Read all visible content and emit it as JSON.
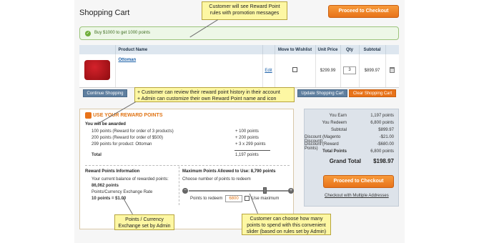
{
  "header": {
    "title": "Shopping Cart",
    "checkout_top": "Proceed to Checkout"
  },
  "promo": {
    "message": "Buy $1000 to get 1000 points"
  },
  "callouts": {
    "top": "Customer will see Reward Point rules with promotion messages",
    "middle_1": "+ Customer can review their reward point history in their account",
    "middle_2": "+ Admin can customize their own Reward Point name and icon",
    "bottom_left": "Points / Currency Exchange set by Admin",
    "bottom_right": "Customer can choose how many points to spend with this convenient slider (based on rules set by Admin)"
  },
  "cart": {
    "columns": [
      "Product Name",
      "Move to Wishlist",
      "Unit Price",
      "Qty",
      "Subtotal"
    ],
    "item": {
      "name": "Ottoman",
      "edit": "Edit",
      "price": "$299.99",
      "qty": "3",
      "subtotal": "$899.97"
    },
    "continue": "Continue Shopping",
    "update": "Update Shopping Cart",
    "clear": "Clear Shopping Cart"
  },
  "reward": {
    "title": "USE YOUR REWARD POINTS",
    "will_be": "You will be awarded",
    "lines": [
      {
        "label": "100 points (Reward for order of 3 products)",
        "value": "+ 100 points"
      },
      {
        "label": "200 points (Reward for order of $500)",
        "value": "+ 200 points"
      },
      {
        "label": "299 points for product: Ottoman",
        "value": "+ 3 x 299 points"
      }
    ],
    "total_label": "Total",
    "total_value": "1,197 points",
    "info_title": "Reward Points Information",
    "balance_label": "Your current balance of rewarded points:",
    "balance_value": "86,062 points",
    "rate_label": "Points/Currency Exchange Rate",
    "rate_value": "10 points = $1.00",
    "max_title": "Maximum Points Allowed to Use: 8,790 points",
    "choose": "Choose number of points to redeem",
    "redeem_label": "Points to redeem",
    "redeem_value": "6800",
    "use_max": "Use maximum",
    "slider_fraction": 0.77
  },
  "summary": {
    "rows": [
      {
        "label": "You Earn",
        "value": "1,197 points"
      },
      {
        "label": "You Redeem",
        "value": "6,800 points"
      },
      {
        "label": "Subtotal",
        "value": "$899.97"
      },
      {
        "label": "Discount (Magento Discount)",
        "value": "-$21.00"
      },
      {
        "label": "Discount (Reward Points)",
        "value": "-$680.00"
      },
      {
        "label": "Total Points",
        "value": "6,800 points"
      }
    ],
    "grand_label": "Grand Total",
    "grand_value": "$198.97",
    "checkout": "Proceed to Checkout",
    "multi": "Checkout with Multiple Addresses"
  }
}
